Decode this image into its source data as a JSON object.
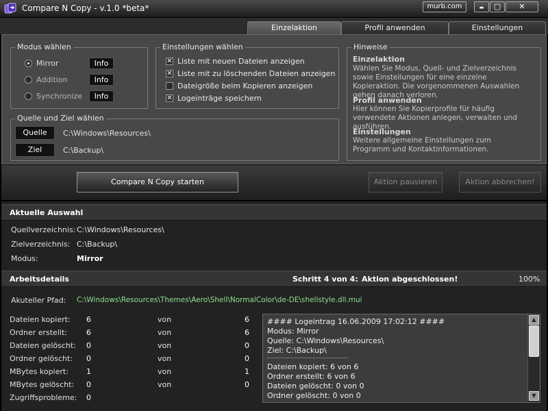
{
  "window": {
    "title": "Compare N Copy - v.1.0 *beta*",
    "murb_label": "murb.com",
    "minimize_glyph": "▬",
    "maximize_glyph": "▢",
    "close_glyph": "✕",
    "app_icon": "compare-copy-app-icon"
  },
  "tabs": [
    {
      "label": "Einzelaktion",
      "active": true
    },
    {
      "label": "Profil anwenden",
      "active": false
    },
    {
      "label": "Einstellungen",
      "active": false
    }
  ],
  "mode_group": {
    "title": "Modus wählen",
    "options": [
      {
        "label": "Mirror",
        "selected": true,
        "info": "Info"
      },
      {
        "label": "Addition",
        "selected": false,
        "info": "Info"
      },
      {
        "label": "Synchronize",
        "selected": false,
        "info": "Info"
      }
    ]
  },
  "settings_group": {
    "title": "Einstellungen wählen",
    "options": [
      {
        "label": "Liste mit neuen Dateien anzeigen",
        "checked": true
      },
      {
        "label": "Liste mit zu löschenden Dateien anzeigen",
        "checked": true
      },
      {
        "label": "Dateigröße beim Kopieren anzeigen",
        "checked": false
      },
      {
        "label": "Logeinträge speichern",
        "checked": true
      }
    ]
  },
  "source_group": {
    "title": "Quelle und Ziel wählen",
    "source_button": "Quelle",
    "source_path": "C:\\Windows\\Resources\\",
    "target_button": "Ziel",
    "target_path": "C:\\Backup\\"
  },
  "hints": {
    "title": "Hinweise",
    "items": [
      {
        "heading": "Einzelaktion",
        "text": "Wählen Sie Modus, Quell- und Zielverzeichnis sowie Einstellungen für eine einzelne Kopieraktion. Die vorgenommenen Auswahlen gehen danach verloren."
      },
      {
        "heading": "Profil anwenden",
        "text": "Hier können Sie Kopierprofile für häufig verwendete Aktionen anlegen, verwalten und ausführen."
      },
      {
        "heading": "Einstellungen",
        "text": "Weitere allgemeine Einstellungen zum Programm und Kontaktinformationen."
      }
    ]
  },
  "actions": {
    "start": "Compare N Copy starten",
    "pause": "Aktion pausieren",
    "abort": "Aktion abbrechen!"
  },
  "current_selection": {
    "title": "Aktuelle Auswahl",
    "source_label": "Quellverzeichnis:",
    "source_value": "C:\\Windows\\Resources\\",
    "target_label": "Zielverzeichnis:",
    "target_value": "C:\\Backup\\",
    "mode_label": "Modus:",
    "mode_value": "Mirror"
  },
  "work_details": {
    "title": "Arbeitsdetails",
    "step": "Schritt 4 von 4:",
    "status": "Aktion abgeschlossen!",
    "percent": "100%",
    "path_label": "Akuteller Pfad:",
    "path_value": "C:\\Windows\\Resources\\Themes\\Aero\\Shell\\NormalColor\\de-DE\\shellstyle.dll.mui",
    "stats": [
      {
        "label": "Dateien kopiert:",
        "value": "6",
        "von": "von",
        "total": "6"
      },
      {
        "label": "Ordner erstellt:",
        "value": "6",
        "von": "von",
        "total": "6"
      },
      {
        "label": "Dateien gelöscht:",
        "value": "0",
        "von": "von",
        "total": "0"
      },
      {
        "label": "Ordner gelöscht:",
        "value": "0",
        "von": "von",
        "total": "0"
      },
      {
        "label": "MBytes kopiert:",
        "value": "1",
        "von": "von",
        "total": "1"
      },
      {
        "label": "MBytes gelöscht:",
        "value": "0",
        "von": "von",
        "total": "0"
      },
      {
        "label": "Zugriffsprobleme:",
        "value": "0",
        "von": "",
        "total": ""
      }
    ]
  },
  "log": {
    "lines": [
      "#### Logeintrag 16.06.2009 17:02:12 ####",
      "Modus: Mirror",
      "Quelle: C:\\Windows\\Resources\\",
      "Ziel: C:\\Backup\\"
    ],
    "lines_after_separator": [
      "Dateien kopiert: 6 von 6",
      "Ordner erstellt: 6 von 6",
      "Dateien gelöscht: 0 von 0",
      "Ordner gelöscht: 0 von 0"
    ],
    "scroll_up_glyph": "▲",
    "scroll_down_glyph": "▼"
  }
}
